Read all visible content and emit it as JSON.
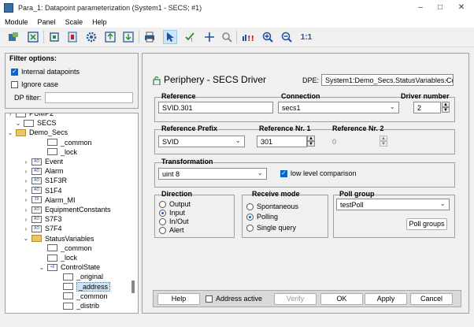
{
  "window": {
    "title": "Para_1: Datapoint parameterization (System1 - SECS; #1)",
    "controls": [
      "–",
      "□",
      "✕"
    ]
  },
  "menu": [
    "Module",
    "Panel",
    "Scale",
    "Help"
  ],
  "toolbar": {
    "icons": [
      "module-icon",
      "close-panel-icon",
      "datapoint-icon",
      "configure-icon",
      "settings-gear-icon",
      "export-icon",
      "import-icon",
      "print-icon",
      "select-pointer-icon",
      "check-icon",
      "move-icon",
      "search-icon",
      "alert-icon",
      "zoom-in-icon",
      "zoom-out-icon",
      "zoom-reset-icon"
    ],
    "zoom_reset_label": "1:1"
  },
  "filter": {
    "header": "Filter options:",
    "internal_label": "Internal datapoints",
    "internal_checked": true,
    "ignore_case_label": "Ignore case",
    "ignore_case_checked": false,
    "dp_filter_label": "DP filter:",
    "dp_filter_value": ""
  },
  "tree": [
    {
      "label": "PUMP2",
      "indent": 1,
      "expander": "›",
      "icon": "dp"
    },
    {
      "label": "SECS",
      "indent": 0,
      "expander": "⌄",
      "icon": "dp"
    },
    {
      "label": "Demo_Secs",
      "indent": 1,
      "expander": "⌄",
      "icon": "folder"
    },
    {
      "label": "_common",
      "indent": 3,
      "expander": "",
      "icon": "cfg"
    },
    {
      "label": "_lock",
      "indent": 3,
      "expander": "",
      "icon": "cfg"
    },
    {
      "label": "Event",
      "indent": 2,
      "expander": "›",
      "icon": "AD"
    },
    {
      "label": "Alarm",
      "indent": 2,
      "expander": "›",
      "icon": "AD"
    },
    {
      "label": "S1F3R",
      "indent": 2,
      "expander": "›",
      "icon": "AD"
    },
    {
      "label": "S1F4",
      "indent": 2,
      "expander": "›",
      "icon": "AD"
    },
    {
      "label": "Alarm_MI",
      "indent": 2,
      "expander": "›",
      "icon": "29"
    },
    {
      "label": "EquipmentConstants",
      "indent": 2,
      "expander": "›",
      "icon": "AD"
    },
    {
      "label": "S7F3",
      "indent": 2,
      "expander": "›",
      "icon": "AD"
    },
    {
      "label": "S7F4",
      "indent": 2,
      "expander": "›",
      "icon": "AD"
    },
    {
      "label": "StatusVariables",
      "indent": 2,
      "expander": "⌄",
      "icon": "folder"
    },
    {
      "label": "_common",
      "indent": 3,
      "expander": "",
      "icon": "cfg"
    },
    {
      "label": "_lock",
      "indent": 3,
      "expander": "",
      "icon": "cfg"
    },
    {
      "label": "ControlState",
      "indent": 3,
      "expander": "⌄",
      "icon": "+6"
    },
    {
      "label": "_original",
      "indent": 4,
      "expander": "",
      "icon": "cfg"
    },
    {
      "label": "_address",
      "indent": 4,
      "expander": "",
      "icon": "cfg",
      "selected": true
    },
    {
      "label": "_common",
      "indent": 4,
      "expander": "",
      "icon": "cfg"
    },
    {
      "label": "_distrib",
      "indent": 4,
      "expander": "",
      "icon": "cfg"
    }
  ],
  "panel": {
    "title": "Periphery - SECS Driver",
    "dpe_label": "DPE:",
    "dpe_value": "System1:Demo_Secs.StatusVariables.Co",
    "reference_title": "Reference",
    "reference_value": "SVID.301",
    "connection_title": "Connection",
    "connection_value": "secs1",
    "driver_title": "Driver number",
    "driver_value": "2",
    "prefix_title": "Reference Prefix",
    "prefix_value": "SVID",
    "nr1_title": "Reference Nr. 1",
    "nr1_value": "301",
    "nr2_title": "Reference Nr. 2",
    "nr2_value": "0",
    "transformation_title": "Transformation",
    "transformation_value": "uint 8",
    "low_level_label": "low level comparison",
    "low_level_checked": true,
    "direction_title": "Direction",
    "direction_options": [
      "Output",
      "Input",
      "In/Out",
      "Alert"
    ],
    "direction_selected": "Input",
    "receive_title": "Receive mode",
    "receive_options": [
      "Spontaneous",
      "Polling",
      "Single query"
    ],
    "receive_selected": "Polling",
    "poll_title": "Poll group",
    "poll_value": "testPoll",
    "poll_groups_btn": "Poll groups"
  },
  "buttons": {
    "help": "Help",
    "address_active": "Address active",
    "address_active_checked": false,
    "verify": "Verify",
    "ok": "OK",
    "apply": "Apply",
    "cancel": "Cancel"
  },
  "colors": {
    "accent": "#0a64c8",
    "selection": "#cce4f7",
    "lock_icon": "#2e7d32"
  }
}
